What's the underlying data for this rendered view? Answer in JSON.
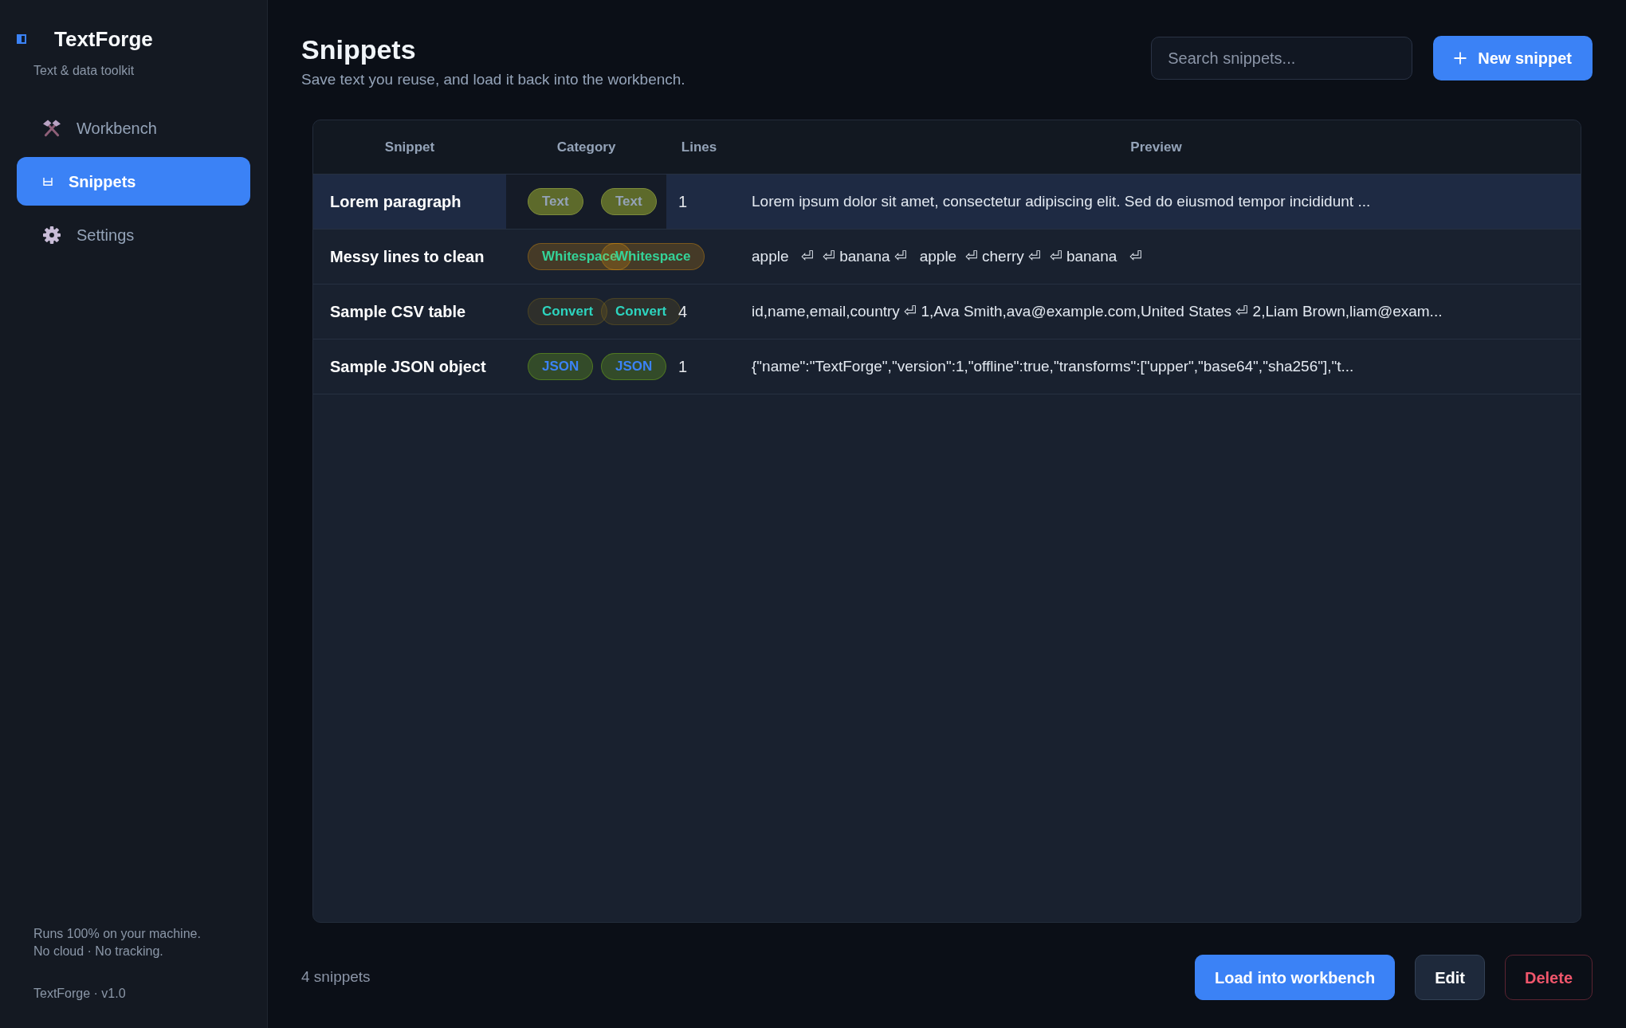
{
  "sidebar": {
    "brand": "TextForge",
    "tagline": "Text & data toolkit",
    "nav": [
      {
        "label": "Workbench",
        "selected": false
      },
      {
        "label": "Snippets",
        "selected": true
      },
      {
        "label": "Settings",
        "selected": false
      }
    ],
    "note": [
      "Runs 100% on your machine.",
      "No cloud · No tracking."
    ],
    "version": "TextForge · v1.0"
  },
  "header": {
    "title": "Snippets",
    "subtitle": "Save text you reuse, and load it back into the workbench.",
    "search": {
      "placeholder": "Search snippets..."
    },
    "new_button": "New snippet"
  },
  "table": {
    "columns": [
      "Snippet",
      "Category",
      "Lines",
      "Preview"
    ],
    "rows": [
      {
        "name": "Lorem paragraph",
        "tags": [
          {
            "label": "Text",
            "kind": "text"
          },
          {
            "label": "Text",
            "kind": "text"
          }
        ],
        "lines": "1",
        "preview": "Lorem ipsum dolor sit amet, consectetur adipiscing elit. Sed do eiusmod tempor incididunt ...",
        "selected": true
      },
      {
        "name": "Messy lines to clean",
        "tags": [
          {
            "label": "Whitespace",
            "kind": "whitespace"
          },
          {
            "label": "Whitespace",
            "kind": "whitespace"
          }
        ],
        "preview": "apple   ⏎  ⏎ banana ⏎   apple  ⏎ cherry ⏎  ⏎ banana   ⏎",
        "selected": false
      },
      {
        "name": "Sample CSV table",
        "tags": [
          {
            "label": "Convert",
            "kind": "convert"
          },
          {
            "label": "Convert",
            "kind": "convert"
          }
        ],
        "lines": "4",
        "preview": "id,name,email,country ⏎ 1,Ava Smith,ava@example.com,United States ⏎ 2,Liam Brown,liam@exam...",
        "selected": false
      },
      {
        "name": "Sample JSON object",
        "tags": [
          {
            "label": "JSON",
            "kind": "json"
          },
          {
            "label": "JSON",
            "kind": "json"
          }
        ],
        "lines": "1",
        "preview": "{\"name\":\"TextForge\",\"version\":1,\"offline\":true,\"transforms\":[\"upper\",\"base64\",\"sha256\"],\"t...",
        "selected": false
      }
    ]
  },
  "footer": {
    "count": "4 snippets",
    "buttons": [
      {
        "label": "Load into workbench",
        "kind": "primary"
      },
      {
        "label": "Edit",
        "kind": "secondary"
      },
      {
        "label": "Delete",
        "kind": "danger"
      }
    ]
  }
}
